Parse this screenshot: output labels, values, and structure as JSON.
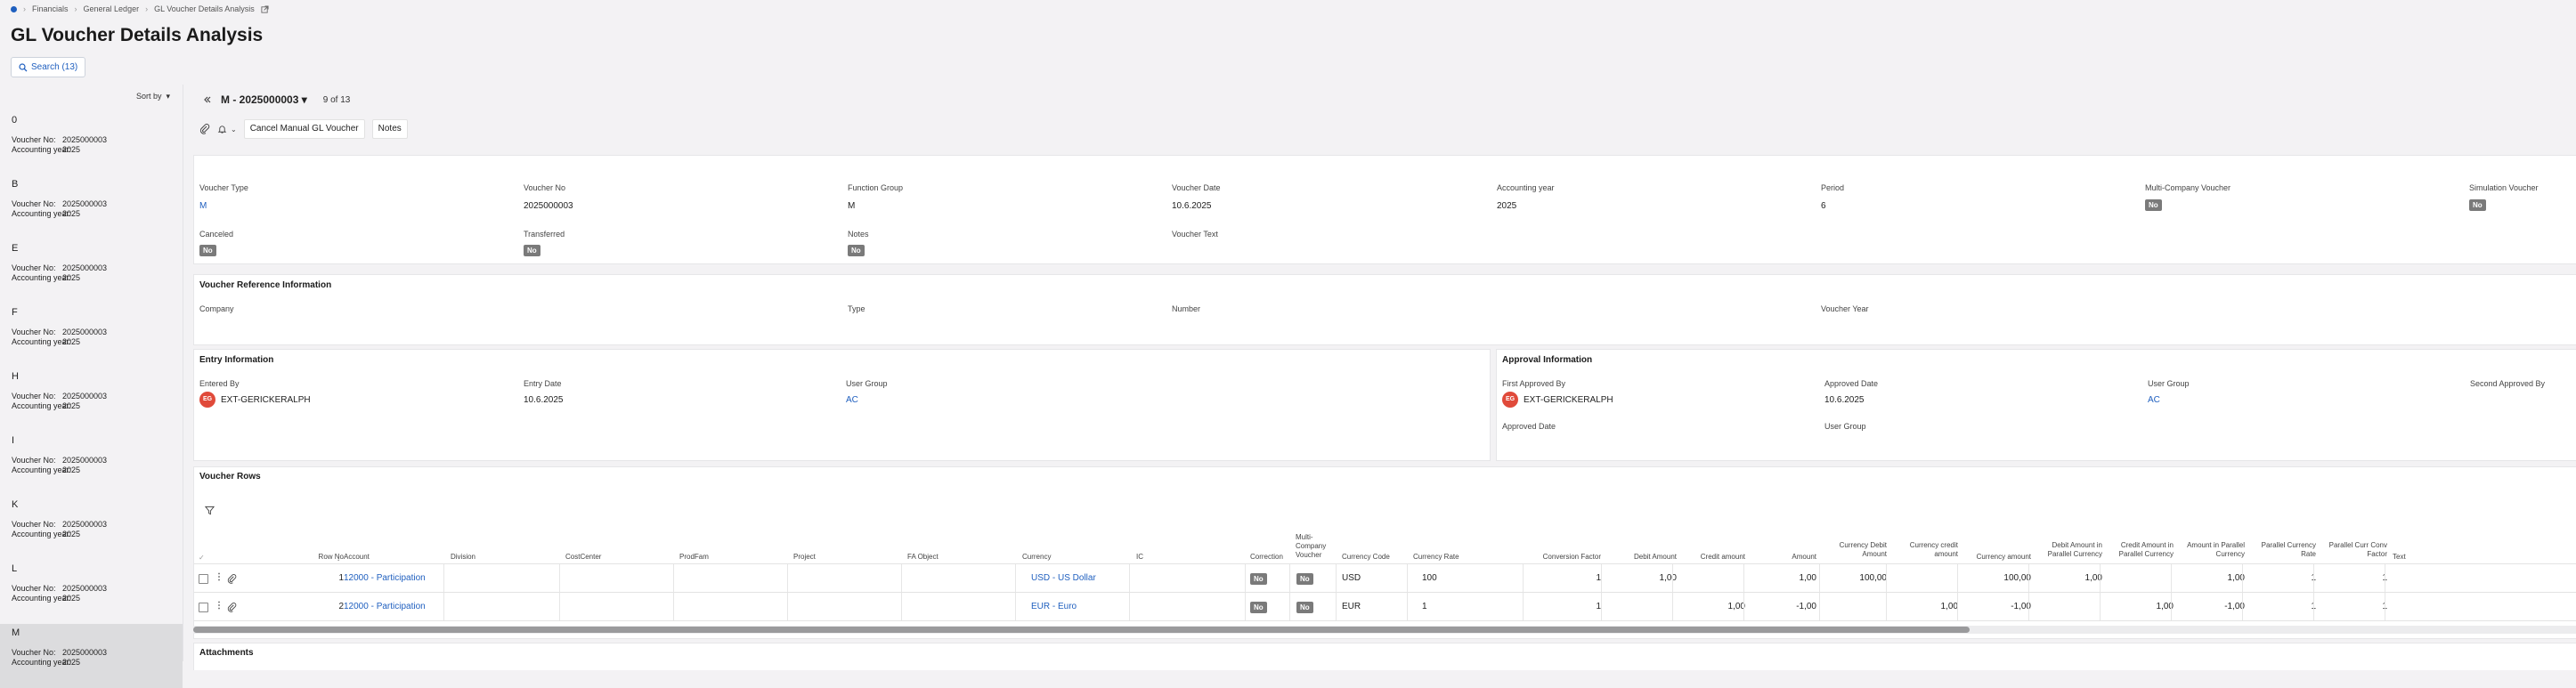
{
  "breadcrumb": [
    "Financials",
    "General Ledger",
    "GL Voucher Details Analysis"
  ],
  "page_title": "GL Voucher Details Analysis",
  "search_button": "Search (13)",
  "sort_by": "Sort by",
  "list": {
    "voucher_no_label": "Voucher No:",
    "accounting_year_label": "Accounting year:",
    "items": [
      {
        "key": "0",
        "voucher_no": "2025000003",
        "year": "2025"
      },
      {
        "key": "B",
        "voucher_no": "2025000003",
        "year": "2025"
      },
      {
        "key": "E",
        "voucher_no": "2025000003",
        "year": "2025"
      },
      {
        "key": "F",
        "voucher_no": "2025000003",
        "year": "2025"
      },
      {
        "key": "H",
        "voucher_no": "2025000003",
        "year": "2025"
      },
      {
        "key": "I",
        "voucher_no": "2025000003",
        "year": "2025"
      },
      {
        "key": "K",
        "voucher_no": "2025000003",
        "year": "2025"
      },
      {
        "key": "L",
        "voucher_no": "2025000003",
        "year": "2025"
      },
      {
        "key": "M",
        "voucher_no": "2025000003",
        "year": "2025"
      }
    ]
  },
  "record_nav": {
    "current": "M - 2025000003",
    "position": "9 of 13"
  },
  "toolbar": {
    "cancel_label": "Cancel Manual GL Voucher",
    "notes_label": "Notes"
  },
  "header_fields": {
    "voucher_type": {
      "label": "Voucher Type",
      "value": "M"
    },
    "voucher_no": {
      "label": "Voucher No",
      "value": "2025000003"
    },
    "function_group": {
      "label": "Function Group",
      "value": "M"
    },
    "voucher_date": {
      "label": "Voucher Date",
      "value": "10.6.2025"
    },
    "accounting_year": {
      "label": "Accounting year",
      "value": "2025"
    },
    "period": {
      "label": "Period",
      "value": "6"
    },
    "multi_company": {
      "label": "Multi-Company Voucher",
      "value": "No"
    },
    "simulation": {
      "label": "Simulation Voucher",
      "value": "No"
    },
    "canceled": {
      "label": "Canceled",
      "value": "No"
    },
    "transferred": {
      "label": "Transferred",
      "value": "No"
    },
    "notes": {
      "label": "Notes",
      "value": "No"
    },
    "voucher_text": {
      "label": "Voucher Text",
      "value": ""
    }
  },
  "voucher_reference": {
    "title": "Voucher Reference Information",
    "company": "Company",
    "type": "Type",
    "number": "Number",
    "voucher_year": "Voucher Year"
  },
  "entry_info": {
    "title": "Entry Information",
    "entered_by_label": "Entered By",
    "entered_by_initials": "EG",
    "entered_by": "EXT-GERICKERALPH",
    "entry_date_label": "Entry Date",
    "entry_date": "10.6.2025",
    "user_group_label": "User Group",
    "user_group": "AC"
  },
  "approval_info": {
    "title": "Approval Information",
    "first_approved_by_label": "First Approved By",
    "first_approved_by_initials": "EG",
    "first_approved_by": "EXT-GERICKERALPH",
    "approved_date_label": "Approved Date",
    "approved_date": "10.6.2025",
    "user_group_label": "User Group",
    "user_group": "AC",
    "second_approved_by_label": "Second Approved By",
    "approved_date2_label": "Approved Date",
    "user_group2_label": "User Group"
  },
  "voucher_rows": {
    "title": "Voucher Rows",
    "headers": {
      "row_no": "Row No",
      "account": "Account",
      "division": "Division",
      "cost_center": "CostCenter",
      "prod_fam": "ProdFam",
      "project": "Project",
      "fa_object": "FA Object",
      "currency": "Currency",
      "ic": "IC",
      "correction": "Correction",
      "multi_company": "Multi-Company Voucher",
      "currency_code": "Currency Code",
      "currency_rate": "Currency Rate",
      "conversion_factor": "Conversion Factor",
      "debit_amount": "Debit Amount",
      "credit_amount": "Credit amount",
      "amount": "Amount",
      "currency_debit": "Currency Debit Amount",
      "currency_credit": "Currency credit amount",
      "currency_amount": "Currency amount",
      "debit_parallel": "Debit Amount in Parallel Currency",
      "credit_parallel": "Credit Amount in Parallel Currency",
      "amount_parallel": "Amount in Parallel Currency",
      "parallel_rate": "Parallel Currency Rate",
      "parallel_conv": "Parallel Curr Conv Factor",
      "text": "Text"
    },
    "rows": [
      {
        "row_no": "1",
        "account": "12000 - Participation",
        "currency": "USD - US Dollar",
        "correction": "No",
        "multi_company": "No",
        "currency_code": "USD",
        "currency_rate": "100",
        "conversion_factor": "1",
        "debit_amount": "1,00",
        "credit_amount": "",
        "amount": "1,00",
        "currency_debit": "100,00",
        "currency_credit": "",
        "currency_amount": "100,00",
        "debit_parallel": "1,00",
        "credit_parallel": "",
        "amount_parallel": "1,00",
        "parallel_rate": "1",
        "parallel_conv": "1"
      },
      {
        "row_no": "2",
        "account": "12000 - Participation",
        "currency": "EUR - Euro",
        "correction": "No",
        "multi_company": "No",
        "currency_code": "EUR",
        "currency_rate": "1",
        "conversion_factor": "1",
        "debit_amount": "",
        "credit_amount": "1,00",
        "amount": "-1,00",
        "currency_debit": "",
        "currency_credit": "1,00",
        "currency_amount": "-1,00",
        "debit_parallel": "",
        "credit_parallel": "1,00",
        "amount_parallel": "-1,00",
        "parallel_rate": "1",
        "parallel_conv": "1"
      }
    ]
  },
  "attachments_title": "Attachments",
  "colors": {
    "accent": "#1f5fbf",
    "badge": "#7a7a7a",
    "avatar": "#e04a3a",
    "selected": "#dcdcde"
  }
}
